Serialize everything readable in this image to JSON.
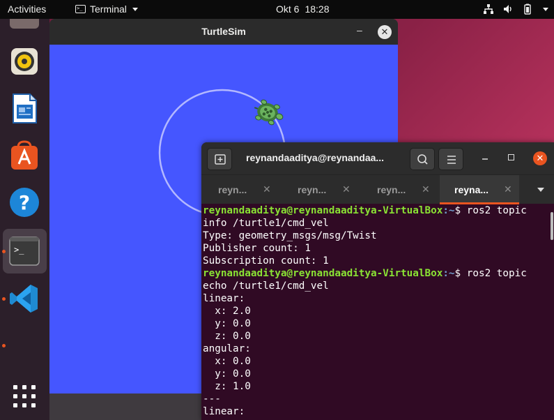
{
  "topbar": {
    "activities": "Activities",
    "app_menu_label": "Terminal",
    "date": "Okt 6",
    "time": "18:28"
  },
  "dock": {
    "items": [
      {
        "name": "rhythmbox-icon"
      },
      {
        "name": "libreoffice-writer-icon"
      },
      {
        "name": "ubuntu-software-icon"
      },
      {
        "name": "help-icon"
      },
      {
        "name": "terminal-icon",
        "active": true
      },
      {
        "name": "vscode-icon"
      },
      {
        "name": "show-applications-icon"
      }
    ]
  },
  "turtlesim": {
    "title": "TurtleSim",
    "minimize": "–",
    "close": "✕",
    "background_color": "#4556ff",
    "path_color": "#b3b8ff"
  },
  "terminal": {
    "title": "reynandaaditya@reynandaa...",
    "close": "✕",
    "tabs": [
      {
        "label": "reyn...",
        "close": "✕",
        "active": false
      },
      {
        "label": "reyn...",
        "close": "✕",
        "active": false
      },
      {
        "label": "reyn...",
        "close": "✕",
        "active": false
      },
      {
        "label": "reyna...",
        "close": "✕",
        "active": true
      }
    ],
    "lines": [
      {
        "prompt": "reynandaaditya@reynandaaditya-VirtualBox",
        "path": ":~",
        "text": "$ ros2 topic"
      },
      {
        "text": "info /turtle1/cmd_vel"
      },
      {
        "text": "Type: geometry_msgs/msg/Twist"
      },
      {
        "text": "Publisher count: 1"
      },
      {
        "text": "Subscription count: 1"
      },
      {
        "prompt": "reynandaaditya@reynandaaditya-VirtualBox",
        "path": ":~",
        "text": "$ ros2 topic"
      },
      {
        "text": "echo /turtle1/cmd_vel"
      },
      {
        "text": "linear:"
      },
      {
        "text": "  x: 2.0"
      },
      {
        "text": "  y: 0.0"
      },
      {
        "text": "  z: 0.0"
      },
      {
        "text": "angular:"
      },
      {
        "text": "  x: 0.0"
      },
      {
        "text": "  y: 0.0"
      },
      {
        "text": "  z: 1.0"
      },
      {
        "text": "---"
      },
      {
        "text": "linear:"
      }
    ],
    "colors": {
      "background": "#300a24",
      "prompt": "#8ae234",
      "path": "#729fcf",
      "accent": "#e95420"
    }
  }
}
